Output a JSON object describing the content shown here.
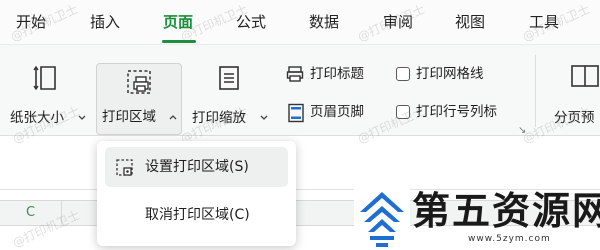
{
  "tabs": [
    {
      "label": "开始",
      "active": false
    },
    {
      "label": "插入",
      "active": false
    },
    {
      "label": "页面",
      "active": true
    },
    {
      "label": "公式",
      "active": false
    },
    {
      "label": "数据",
      "active": false
    },
    {
      "label": "审阅",
      "active": false
    },
    {
      "label": "视图",
      "active": false
    },
    {
      "label": "工具",
      "active": false
    }
  ],
  "ribbon": {
    "paper_size": "纸张大小",
    "print_area": "打印区域",
    "print_scale": "打印缩放",
    "print_titles": "打印标题",
    "header_footer": "页眉页脚",
    "print_gridlines": "打印网格线",
    "print_row_col_headers": "打印行号列标",
    "page_break_preview": "分页预"
  },
  "dropdown": {
    "items": [
      {
        "label": "设置打印区域(S)"
      },
      {
        "label": "取消打印区域(C)"
      }
    ]
  },
  "sheet": {
    "column_label": "C"
  },
  "watermark": {
    "text": "@打印机卫士"
  },
  "logo": {
    "text": "第五资源网",
    "url": "www.5zym.com"
  },
  "colors": {
    "accent": "#1a8f3c",
    "logo_blue": "#1f6fd1"
  }
}
